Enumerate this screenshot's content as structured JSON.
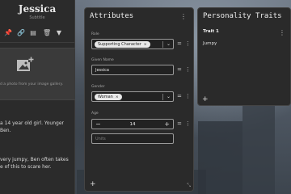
{
  "character": {
    "name": "Jessica",
    "subtitle": "Subtitle",
    "image_hint": "d a photo from your image gallery.",
    "bio": [
      "a 14 year old girl. Younger\nBen.",
      "very jumpy, Ben often takes\ne of this to scare her."
    ]
  },
  "toolbar": {
    "icons": [
      "pin-icon",
      "link-icon",
      "book-icon",
      "trash-icon",
      "filter-icon"
    ],
    "glyphs": [
      "📌",
      "🔗",
      "▤",
      "🗑",
      "▼"
    ]
  },
  "attributes": {
    "title": "Attributes",
    "role": {
      "label": "Role",
      "chip": "Supporting Character",
      "chip_x": "×"
    },
    "given_name": {
      "label": "Given Name",
      "value": "Jessica"
    },
    "gender": {
      "label": "Gender",
      "chip": "Woman",
      "chip_x": "×"
    },
    "age": {
      "label": "Age",
      "value": "14",
      "minus": "−",
      "plus": "+"
    },
    "units": {
      "placeholder": "Units"
    },
    "add": "+",
    "resize": "⤡"
  },
  "traits": {
    "title": "Personality Traits",
    "header": "Trait 1",
    "value": "Jumpy",
    "add": "+"
  },
  "icons": {
    "kebab": "⋮",
    "drag": "=",
    "chevron": "⌄"
  }
}
